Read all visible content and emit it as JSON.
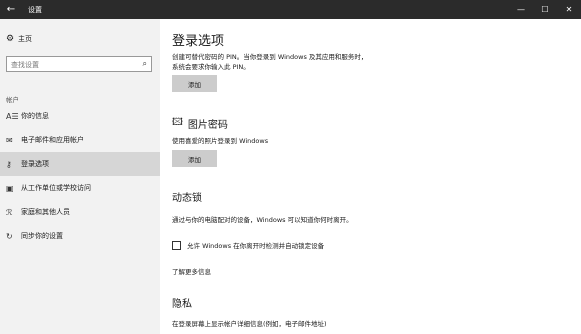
{
  "window": {
    "title": "设置",
    "back_glyph": "←",
    "minimize_glyph": "—",
    "maximize_glyph": "☐"
  },
  "sidebar": {
    "home_label": "主页",
    "search_placeholder": "查找设置",
    "group_heading": "帐户",
    "items": [
      {
        "label": "你的信息",
        "icon": "person-card-icon"
      },
      {
        "label": "电子邮件和应用帐户",
        "icon": "mail-icon"
      },
      {
        "label": "登录选项",
        "icon": "key-icon"
      },
      {
        "label": "从工作单位或学校访问",
        "icon": "briefcase-icon"
      },
      {
        "label": "家庭和其他人员",
        "icon": "people-icon"
      },
      {
        "label": "同步你的设置",
        "icon": "sync-icon"
      }
    ]
  },
  "main": {
    "title": "登录选项",
    "pin_desc_line1": "创建可替代密码的 PIN。当你登录到 Windows 及其应用和服务时，",
    "pin_desc_line2": "系统会要求你输入此 PIN。",
    "pin_add_label": "添加",
    "picture_title": "图片密码",
    "picture_desc": "使用喜爱的照片登录到 Windows",
    "picture_add_label": "添加",
    "dynamic_lock_title": "动态锁",
    "dynamic_lock_desc": "通过与你的电脑配对的设备，Windows 可以知道你何时离开。",
    "dynamic_lock_checkbox_label": "允许 Windows 在你离开时检测并自动锁定设备",
    "learn_more_label": "了解更多信息",
    "privacy_title": "隐私",
    "privacy_desc": "在登录屏幕上显示帐户详细信息(例如，电子邮件地址)"
  }
}
